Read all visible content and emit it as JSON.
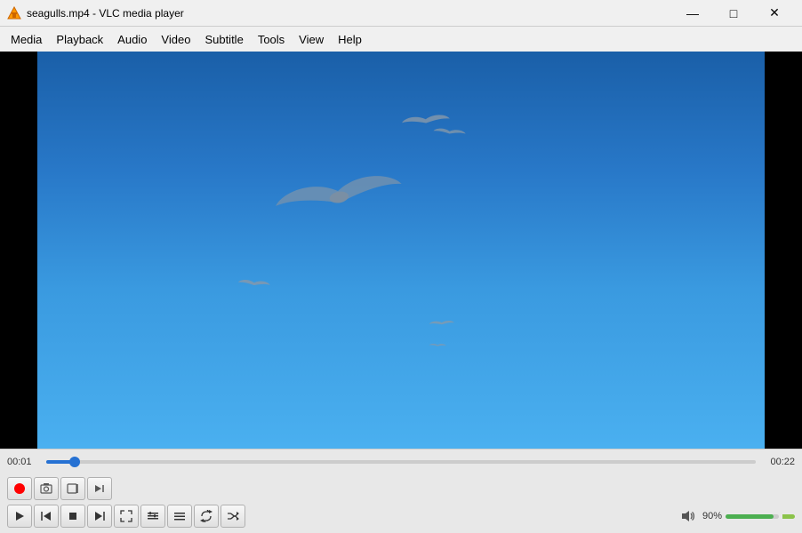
{
  "titlebar": {
    "icon": "🔶",
    "title": "seagulls.mp4 - VLC media player",
    "minimize": "—",
    "maximize": "□",
    "close": "✕"
  },
  "menu": {
    "items": [
      "Media",
      "Playback",
      "Audio",
      "Video",
      "Subtitle",
      "Tools",
      "View",
      "Help"
    ]
  },
  "video": {
    "filename": "seagulls.mp4"
  },
  "progress": {
    "current": "00:01",
    "total": "00:22",
    "percent": 4
  },
  "controls_row1": {
    "record_label": "●",
    "snapshot_label": "📷",
    "loop_label": "⊡",
    "frame_label": "▶|"
  },
  "controls_row2": {
    "play_label": "▶",
    "prev_label": "|◀◀",
    "stop_label": "■",
    "next_label": "▶▶|",
    "fullscreen_label": "⛶",
    "extended_label": "≡≡",
    "playlist_label": "☰",
    "loop_label": "↺",
    "random_label": "⇄"
  },
  "volume": {
    "percent": "90%",
    "icon": "🔊"
  }
}
